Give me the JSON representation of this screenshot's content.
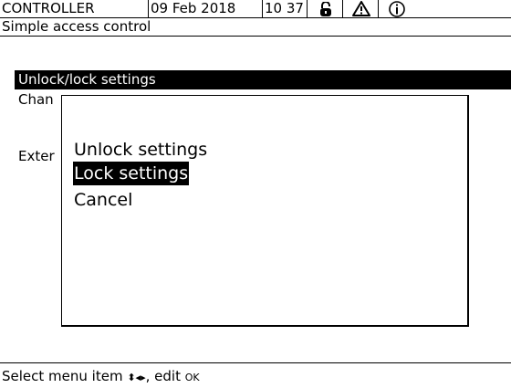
{
  "status_bar": {
    "device": "CONTROLLER",
    "date": "09 Feb  2018",
    "time": "10 37",
    "icons": [
      "lock-open-icon",
      "warning-icon",
      "info-icon"
    ]
  },
  "screen_title": "Simple access control",
  "menu": {
    "items": [
      {
        "label": "Unlock/lock settings",
        "selected": true
      },
      {
        "label": "Chan",
        "selected": false
      },
      {
        "label": "Exter",
        "selected": false
      }
    ]
  },
  "dialog": {
    "options": [
      {
        "label": "Unlock settings",
        "selected": false
      },
      {
        "label": "Lock settings",
        "selected": true
      },
      {
        "label": "Cancel",
        "selected": false
      }
    ]
  },
  "footer": {
    "hint_prefix": "Select menu item",
    "nav_glyph": "⬍◂▸",
    "hint_middle": ", edit",
    "ok_glyph": "OK"
  }
}
